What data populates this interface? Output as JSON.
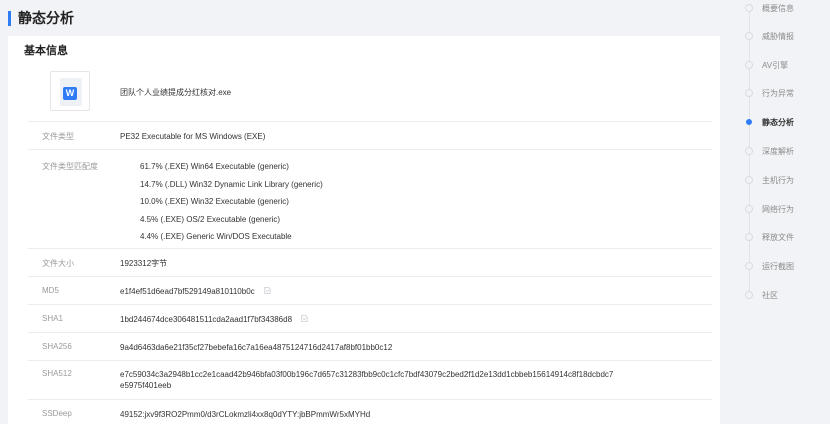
{
  "section": {
    "title": "静态分析"
  },
  "card": {
    "title": "基本信息"
  },
  "file": {
    "name": "团队个人业绩提成分红核对.exe",
    "icon": "wps-document-icon"
  },
  "rows": {
    "type": {
      "label": "文件类型",
      "value": "PE32 Executable for MS Windows (EXE)"
    },
    "match": {
      "label": "文件类型匹配度",
      "items": [
        "61.7% (.EXE) Win64 Executable (generic)",
        "14.7% (.DLL) Win32 Dynamic Link Library (generic)",
        "10.0% (.EXE) Win32 Executable (generic)",
        "4.5% (.EXE) OS/2 Executable (generic)",
        "4.4% (.EXE) Generic Win/DOS Executable"
      ]
    },
    "size": {
      "label": "文件大小",
      "value": "1923312字节"
    },
    "md5": {
      "label": "MD5",
      "value": "e1f4ef51d6ead7bf529149a810110b0c"
    },
    "sha1": {
      "label": "SHA1",
      "value": "1bd244674dce306481511cda2aad1f7bf34386d8"
    },
    "sha256": {
      "label": "SHA256",
      "value": "9a4d6463da6e21f35cf27bebefa16c7a16ea4875124716d2417af8bf01bb0c12"
    },
    "sha512": {
      "label": "SHA512",
      "value_line1": "e7c59034c3a2948b1cc2e1caad42b946bfa03f00b196c7d657c31283fbb9c0c1cfc7bdf43079c2bed2f1d2e13dd1cbbeb15614914c8f18dcbdc7",
      "value_line2": "e5975f401eeb"
    },
    "ssdeep": {
      "label": "SSDeep",
      "value": "49152:jxv9f3RO2Pmm0/d3rCLokmzli4xx8q0dYTY:jbBPmmWr5xMYHd"
    }
  },
  "nav": {
    "items": [
      "概要信息",
      "威胁情报",
      "AV引擎",
      "行为异常",
      "静态分析",
      "深度解析",
      "主机行为",
      "网络行为",
      "释放文件",
      "运行截图",
      "社区"
    ],
    "active": "静态分析"
  },
  "colors": {
    "accent": "#2f7cf6",
    "background": "#f2f3f6"
  }
}
